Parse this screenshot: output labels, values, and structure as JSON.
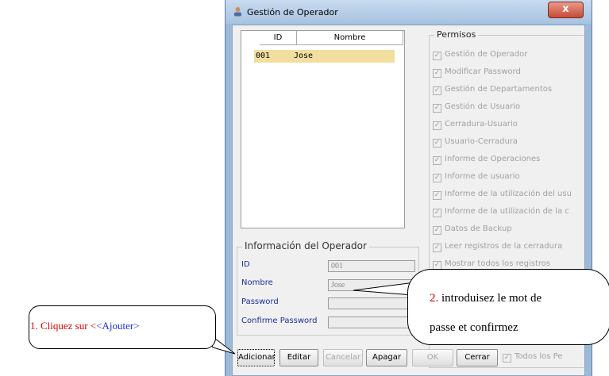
{
  "window": {
    "title": "Gestión de Operador",
    "close_label": "x"
  },
  "table": {
    "headers": [
      "ID",
      "Nombre"
    ],
    "rows": [
      {
        "id": "001",
        "nombre": "Jose"
      }
    ]
  },
  "operator_info": {
    "title": "Información del Operador",
    "id_label": "ID",
    "id_value": "001",
    "nombre_label": "Nombre",
    "nombre_value": "Jose",
    "password_label": "Password",
    "password_value": "",
    "confirm_label": "Confirme Password",
    "confirm_value": ""
  },
  "permissions": {
    "title": "Permisos",
    "items": [
      "Gestión de Operador",
      "Modificar Password",
      "Gestión de Departamentos",
      "Gestión de Usuario",
      "Cerradura-Usuario",
      "Usuario-Cerradura",
      "Informe de Operaciones",
      "Informe de usuario",
      "Informe de la utilización del usu",
      "Informe de la utilización de la c",
      "Datos de Backup",
      "Leer registros de la cerradura",
      "Mostrar todos los registros"
    ],
    "todos_label": "Todos los Pe"
  },
  "buttons": {
    "adicionar": "Adicionar",
    "editar": "Editar",
    "cancelar": "Cancelar",
    "apagar": "Apagar",
    "ok": "OK",
    "cerrar": "Cerrar"
  },
  "callouts": {
    "step1_number": "1. Cliquez sur <",
    "step1_action": "<Ajouter>",
    "step2_number": "2.",
    "step2_line1": "introduisez le mot de",
    "step2_line2": "passe et confirmez"
  },
  "colors": {
    "selected_row": "#f2dfa0",
    "label_blue": "#1a2f9a",
    "callout_red": "#d40000"
  }
}
